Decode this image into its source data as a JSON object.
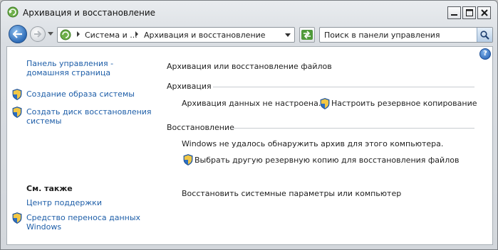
{
  "window": {
    "title": "Архивация и восстановление"
  },
  "address": {
    "crumbs": [
      "Система и ...",
      "Архивация и восстановление"
    ]
  },
  "search": {
    "placeholder": "Поиск в панели управления"
  },
  "sidebar": {
    "home_link": [
      "Панель управления -",
      "домашняя страница"
    ],
    "tasks": [
      {
        "label": [
          "Создание образа системы"
        ],
        "icon": "shield-icon"
      },
      {
        "label": [
          "Создать диск восстановления",
          "системы"
        ],
        "icon": "shield-icon"
      }
    ],
    "see_also_heading": "См. также",
    "see_also": [
      {
        "label": [
          "Центр поддержки"
        ],
        "icon": null
      },
      {
        "label": [
          "Средство переноса данных",
          "Windows"
        ],
        "icon": "shield-icon"
      }
    ]
  },
  "main": {
    "title": "Архивация или восстановление файлов",
    "backup": {
      "heading": "Архивация",
      "status": "Архивация данных не настроена.",
      "setup_link": "Настроить резервное копирование"
    },
    "restore": {
      "heading": "Восстановление",
      "status": "Windows не удалось обнаружить архив для этого компьютера.",
      "choose_link": "Выбрать другую резервную копию для восстановления файлов",
      "recover_link": "Восстановить системные параметры или компьютер"
    }
  },
  "colors": {
    "link": "#1e5ea8",
    "content_bg": "#ffffff"
  }
}
